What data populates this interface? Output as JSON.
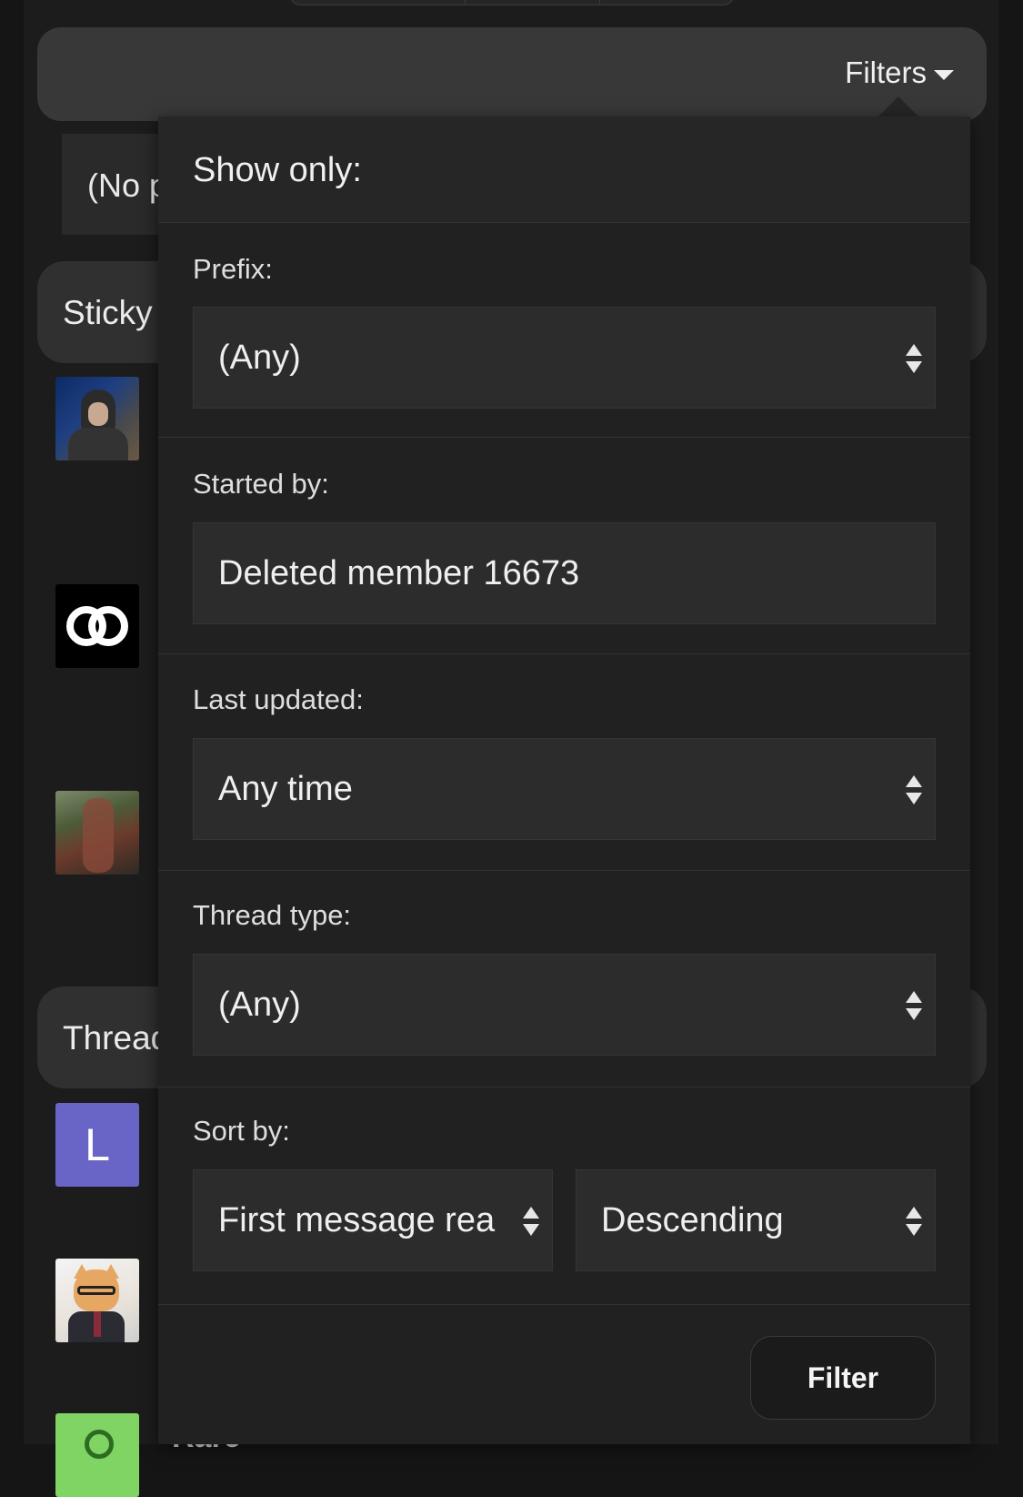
{
  "header": {
    "filters_label": "Filters"
  },
  "background": {
    "prefix_chip_text": "(No p",
    "sticky_section_label": "Sticky",
    "threads_section_label": "Thread",
    "avatars": [
      {
        "name": "hooded-person-avatar"
      },
      {
        "name": "infinity-logo-avatar"
      },
      {
        "name": "game-character-avatar"
      },
      {
        "name": "letter-avatar",
        "letter": "L",
        "color": "#6865c7"
      },
      {
        "name": "cat-in-suit-avatar"
      },
      {
        "name": "green-avatar",
        "color": "#7fd463"
      }
    ],
    "peek_thread_title": "Rare"
  },
  "filter_menu": {
    "title": "Show only:",
    "prefix": {
      "label": "Prefix:",
      "value": "(Any)"
    },
    "started_by": {
      "label": "Started by:",
      "value": "Deleted member 16673"
    },
    "last_updated": {
      "label": "Last updated:",
      "value": "Any time"
    },
    "thread_type": {
      "label": "Thread type:",
      "value": "(Any)"
    },
    "sort_by": {
      "label": "Sort by:",
      "field_value": "First message rea",
      "direction_value": "Descending"
    },
    "submit_label": "Filter"
  },
  "colors": {
    "page_background": "#151515",
    "menu_background": "#212121",
    "field_background": "#2c2c2c",
    "filter_bar_background": "#383838"
  }
}
